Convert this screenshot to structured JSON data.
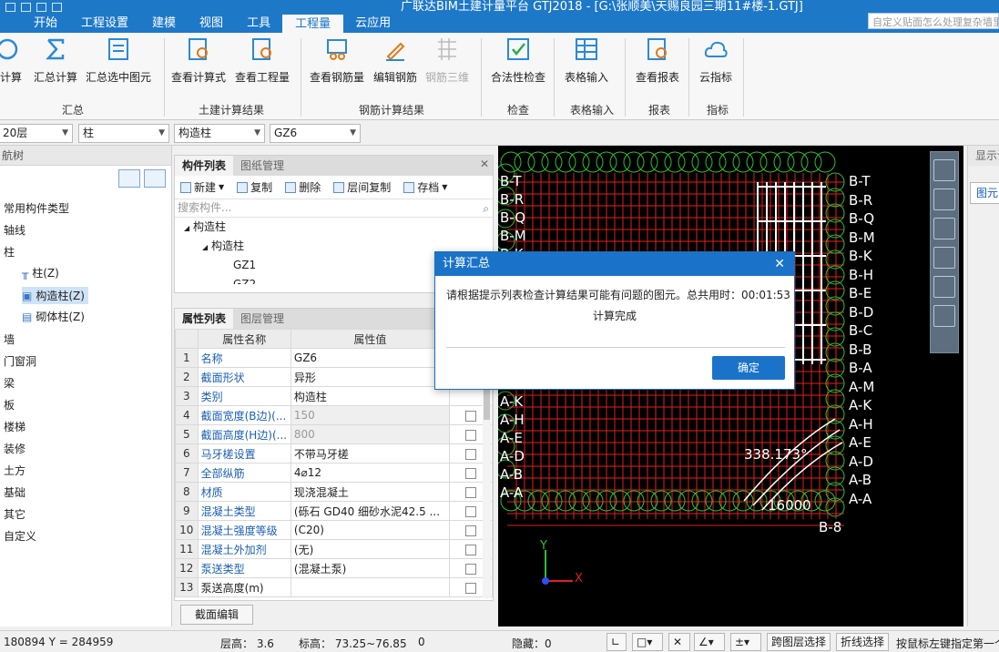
{
  "window": {
    "title": "广联达BIM土建计量平台 GTJ2018 - [G:\\张顺美\\天赐良园三期11#楼-1.GTJ]",
    "search_placeholder": "自定义贴面怎么处理复杂墙里"
  },
  "menu": [
    "开始",
    "工程设置",
    "建模",
    "视图",
    "工具",
    "工程量",
    "云应用"
  ],
  "menu_active": "工程量",
  "ribbon": {
    "buttons": [
      "计算",
      "汇总计算",
      "汇总选中图元",
      "查看计算式",
      "查看工程量",
      "查看钢筋量",
      "编辑钢筋",
      "钢筋三维",
      "合法性检查",
      "表格输入",
      "查看报表",
      "云指标"
    ],
    "groups": [
      "汇总",
      "土建计算结果",
      "钢筋计算结果",
      "检查",
      "表格输入",
      "报表",
      "指标"
    ]
  },
  "selectors": {
    "floor": "20层",
    "category": "柱",
    "type": "构造柱",
    "element": "GZ6"
  },
  "nav": {
    "title": "航树",
    "items": [
      "常用构件类型",
      "轴线",
      "柱",
      "墙",
      "门窗洞",
      "梁",
      "板",
      "楼梯",
      "装修",
      "土方",
      "基础",
      "其它",
      "自定义"
    ],
    "sub_items": [
      "柱(Z)",
      "构造柱(Z)",
      "砌体柱(Z)"
    ]
  },
  "component_list": {
    "tabs": [
      "构件列表",
      "图纸管理"
    ],
    "toolbar": [
      "新建",
      "复制",
      "删除",
      "层间复制",
      "存档"
    ],
    "search_placeholder": "搜索构件...",
    "tree": [
      "构造柱",
      "构造柱",
      "GZ1",
      "GZ2"
    ]
  },
  "property_list": {
    "tabs": [
      "属性列表",
      "图层管理"
    ],
    "headers": [
      "属性名称",
      "属性值"
    ],
    "rows": [
      {
        "no": "1",
        "name": "名称",
        "value": "GZ6"
      },
      {
        "no": "2",
        "name": "截面形状",
        "value": "异形"
      },
      {
        "no": "3",
        "name": "类别",
        "value": "构造柱"
      },
      {
        "no": "4",
        "name": "截面宽度(B边)(...",
        "value": "150"
      },
      {
        "no": "5",
        "name": "截面高度(H边)(...",
        "value": "800"
      },
      {
        "no": "6",
        "name": "马牙槎设置",
        "value": "不带马牙槎"
      },
      {
        "no": "7",
        "name": "全部纵筋",
        "value": "4⌀12"
      },
      {
        "no": "8",
        "name": "材质",
        "value": "现浇混凝土"
      },
      {
        "no": "9",
        "name": "混凝土类型",
        "value": "(砾石 GD40 细砂水泥42.5 ..."
      },
      {
        "no": "10",
        "name": "混凝土强度等级",
        "value": "(C20)"
      },
      {
        "no": "11",
        "name": "混凝土外加剂",
        "value": "(无)"
      },
      {
        "no": "12",
        "name": "泵送类型",
        "value": "(混凝土泵)"
      },
      {
        "no": "13",
        "name": "泵送高度(m)",
        "value": ""
      }
    ],
    "edit_button": "截面编辑"
  },
  "canvas": {
    "axis_labels_right": [
      "B-T",
      "B-R",
      "B-Q",
      "B-M",
      "B-K",
      "B-H",
      "B-E",
      "B-D",
      "B-C",
      "B-B",
      "B-A",
      "A-M",
      "A-K",
      "A-H",
      "A-E",
      "A-D",
      "A-B",
      "A-A"
    ],
    "axis_labels_left": [
      "B-T",
      "B-R",
      "B-Q",
      "B-M",
      "B-K",
      "A-K",
      "A-H",
      "A-E",
      "A-D",
      "A-B",
      "A-A"
    ],
    "dim_text": "338.173°",
    "bottom_dim": "16000",
    "bottom_right_label": "B-8",
    "x_axis": "X",
    "y_axis": "Y"
  },
  "right_panel": {
    "title": "显示设",
    "tab": "图元"
  },
  "status": {
    "coords": "180894 Y = 284959",
    "floor_height": "层高： 3.6",
    "elevation": "标高： 73.25~76.85",
    "count": "0",
    "hidden": "隐藏：0",
    "cross_layer": "跨图层选择",
    "polyline_select": "折线选择",
    "hint": "按鼠标左键指定第一个"
  },
  "modal": {
    "title": "计算汇总",
    "message": "请根据提示列表检查计算结果可能有问题的图元。总共用时：00:01:53",
    "done": "计算完成",
    "ok": "确定"
  },
  "colors": {
    "accent": "#1e78c8",
    "canvas_red": "#e02020",
    "canvas_green": "#2fbf2f"
  }
}
